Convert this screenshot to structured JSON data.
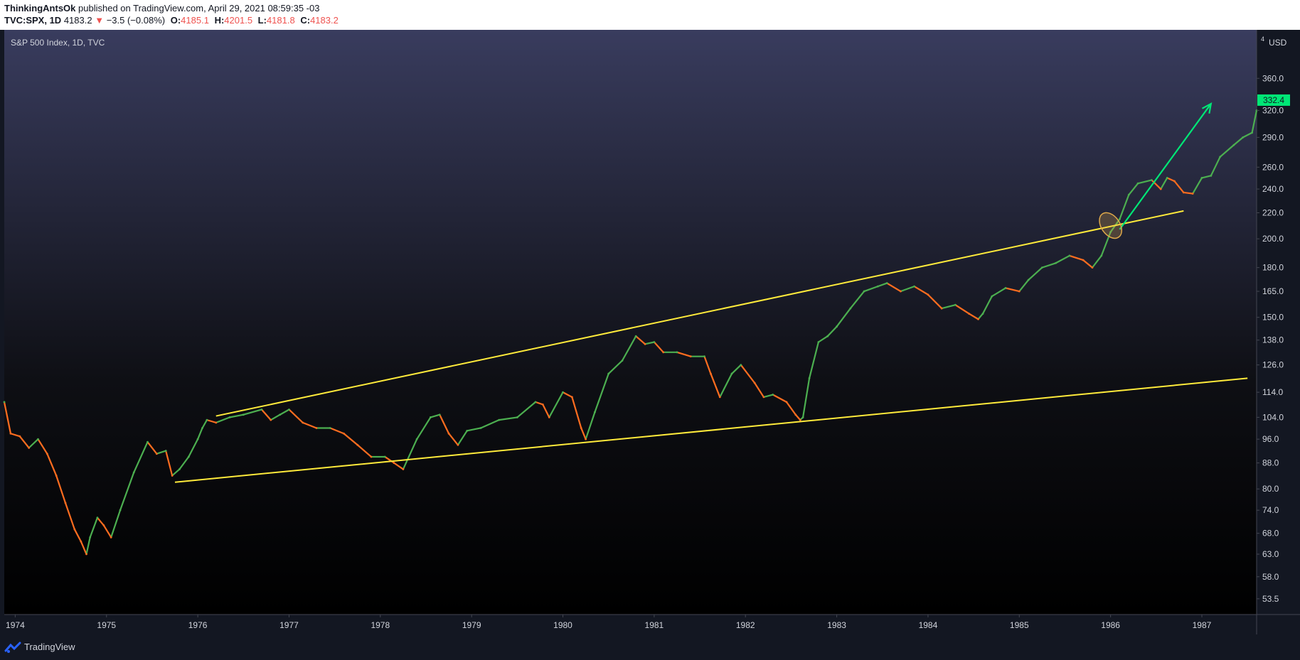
{
  "header": {
    "author": "ThinkingAntsOk",
    "published_text": "published on TradingView.com, April 29, 2021 08:59:35 -03",
    "symbol": "TVC:SPX, 1D",
    "last": "4183.2",
    "change": "−3.5 (−0.08%)",
    "open_label": "O:",
    "open": "4185.1",
    "high_label": "H:",
    "high": "4201.5",
    "low_label": "L:",
    "low": "4181.8",
    "close_label": "C:",
    "close": "4183.2"
  },
  "colors": {
    "up": "#26a69a",
    "down": "#ef5350",
    "candle_up": "#4caf50",
    "candle_down": "#ff6d1f",
    "trendline": "#ffeb3b",
    "arrow": "#00e676",
    "price_badge": "#00e676"
  },
  "chart_data": {
    "type": "line",
    "title": "S&P 500 Index, 1D, TVC",
    "currency": "USD",
    "y_scale": "log",
    "grid": false,
    "xlim": [
      1973.88,
      1987.6
    ],
    "ylim": [
      50.5,
      430
    ],
    "x_ticks": [
      "1974",
      "1975",
      "1976",
      "1977",
      "1978",
      "1979",
      "1980",
      "1981",
      "1982",
      "1983",
      "1984",
      "1985",
      "1986",
      "1987"
    ],
    "y_ticks": [
      "360.0",
      "320.0",
      "290.0",
      "260.0",
      "240.0",
      "220.0",
      "200.0",
      "180.0",
      "165.0",
      "150.0",
      "138.0",
      "126.0",
      "114.0",
      "104.0",
      "96.0",
      "88.0",
      "80.0",
      "74.0",
      "68.0",
      "63.0",
      "58.0",
      "53.5"
    ],
    "last_price_label": "332.4",
    "last_price": 332.4,
    "series": [
      {
        "x": [
          1973.88,
          1973.95,
          1974.05,
          1974.15,
          1974.25,
          1974.35,
          1974.45,
          1974.55,
          1974.65,
          1974.72,
          1974.78,
          1974.82,
          1974.9,
          1974.97,
          1975.05,
          1975.15,
          1975.3,
          1975.45,
          1975.55,
          1975.65,
          1975.72,
          1975.8,
          1975.9,
          1976.0,
          1976.05,
          1976.1,
          1976.2,
          1976.35,
          1976.5,
          1976.7,
          1976.8,
          1976.9,
          1977.0,
          1977.15,
          1977.3,
          1977.45,
          1977.6,
          1977.75,
          1977.9,
          1978.05,
          1978.15,
          1978.25,
          1978.4,
          1978.55,
          1978.65,
          1978.75,
          1978.85,
          1978.95,
          1979.1,
          1979.3,
          1979.5,
          1979.7,
          1979.78,
          1979.85,
          1980.0,
          1980.1,
          1980.2,
          1980.25,
          1980.35,
          1980.5,
          1980.65,
          1980.8,
          1980.9,
          1981.0,
          1981.1,
          1981.25,
          1981.4,
          1981.55,
          1981.62,
          1981.72,
          1981.85,
          1981.95,
          1982.1,
          1982.2,
          1982.3,
          1982.45,
          1982.55,
          1982.6,
          1982.63,
          1982.7,
          1982.8,
          1982.9,
          1983.0,
          1983.15,
          1983.3,
          1983.45,
          1983.55,
          1983.7,
          1983.85,
          1984.0,
          1984.15,
          1984.3,
          1984.45,
          1984.55,
          1984.6,
          1984.7,
          1984.85,
          1985.0,
          1985.1,
          1985.25,
          1985.4,
          1985.55,
          1985.7,
          1985.8,
          1985.9,
          1986.0,
          1986.1,
          1986.2,
          1986.3,
          1986.45,
          1986.55,
          1986.62,
          1986.7,
          1986.8,
          1986.9,
          1987.0,
          1987.1,
          1987.2,
          1987.35,
          1987.45,
          1987.55,
          1987.6
        ],
        "y": [
          110,
          98,
          97,
          93,
          96,
          91,
          84,
          76,
          69,
          66,
          63,
          67,
          72,
          70,
          67,
          74,
          85,
          95,
          91,
          92,
          84,
          86,
          90,
          96,
          100,
          103,
          102,
          104,
          105,
          107,
          103,
          105,
          107,
          102,
          100,
          100,
          98,
          94,
          90,
          90,
          88,
          86,
          96,
          104,
          105,
          98,
          94,
          99,
          100,
          103,
          104,
          110,
          109,
          104,
          114,
          112,
          100,
          96,
          106,
          122,
          128,
          140,
          136,
          137,
          132,
          132,
          130,
          130,
          122,
          112,
          122,
          126,
          118,
          112,
          113,
          110,
          105,
          103,
          104,
          120,
          137,
          140,
          145,
          155,
          165,
          168,
          170,
          165,
          168,
          163,
          155,
          157,
          152,
          149,
          152,
          162,
          167,
          165,
          172,
          180,
          183,
          188,
          185,
          180,
          188,
          205,
          215,
          235,
          245,
          248,
          240,
          250,
          247,
          237,
          236,
          250,
          252,
          270,
          282,
          290,
          295,
          320
        ]
      }
    ],
    "annotations": [
      {
        "type": "trendline",
        "name": "upper-channel-line",
        "from": [
          1976.2,
          104.5
        ],
        "to": [
          1986.8,
          221.5
        ]
      },
      {
        "type": "trendline",
        "name": "lower-channel-line",
        "from": [
          1975.75,
          82
        ],
        "to": [
          1987.5,
          120
        ]
      },
      {
        "type": "arrow",
        "name": "breakout-arrow",
        "from": [
          1986.1,
          207
        ],
        "to": [
          1987.1,
          328
        ]
      },
      {
        "type": "ellipse",
        "name": "breakout-highlight",
        "center": [
          1986.0,
          210
        ]
      }
    ]
  },
  "footer": {
    "brand": "TradingView"
  }
}
